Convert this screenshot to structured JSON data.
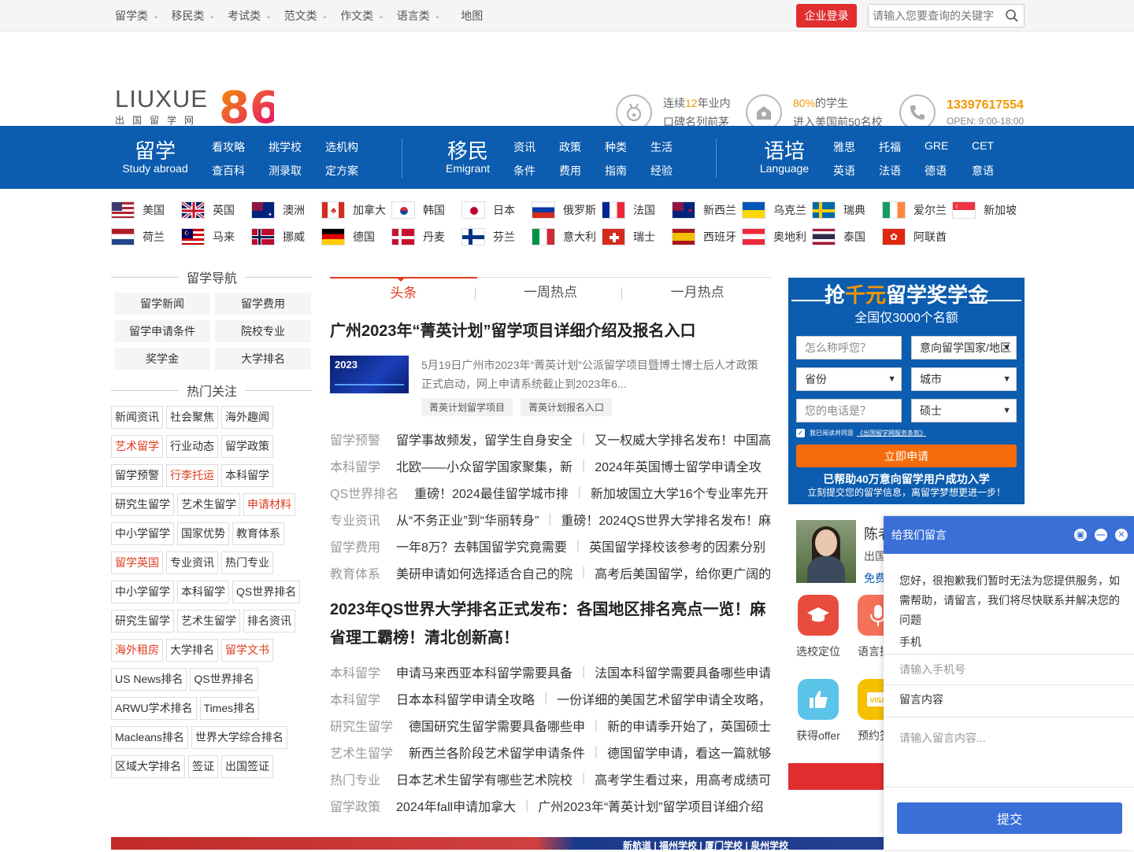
{
  "topnav": {
    "items": [
      {
        "label": "留学类"
      },
      {
        "label": "移民类"
      },
      {
        "label": "考试类"
      },
      {
        "label": "范文类"
      },
      {
        "label": "作文类"
      },
      {
        "label": "语言类"
      }
    ],
    "map": "地图",
    "corp_login": "企业登录",
    "search_placeholder": "请输入您要查询的关键字"
  },
  "header": {
    "logo_text": "LIUXUE",
    "logo_num": "86",
    "logo_sub": "出国留学网",
    "badge1_pre": "连续",
    "badge1_num": "12",
    "badge1_post": "年业内",
    "badge1_line2": "口碑名列前茅",
    "badge2_pct": "80%",
    "badge2_post": "的学生",
    "badge2_line2": "进入美国前50名校",
    "phone": "13397617554",
    "open": "OPEN: 9:00-18:00"
  },
  "bluebar": {
    "study_big": "留学",
    "study_en": "Study abroad",
    "study_links": [
      "看攻略",
      "挑学校",
      "选机构",
      "查百科",
      "测录取",
      "定方案"
    ],
    "emig_big": "移民",
    "emig_en": "Emigrant",
    "emig_links": [
      "资讯",
      "政策",
      "种类",
      "生活",
      "条件",
      "费用",
      "指南",
      "经验"
    ],
    "lang_big": "语培",
    "lang_en": "Language",
    "lang_links": [
      "雅思",
      "托福",
      "GRE",
      "CET",
      "英语",
      "法语",
      "德语",
      "意语"
    ]
  },
  "flags": {
    "row1": [
      "美国",
      "英国",
      "澳洲",
      "加拿大",
      "韩国",
      "日本",
      "俄罗斯",
      "法国",
      "新西兰",
      "乌克兰",
      "瑞典",
      "爱尔兰",
      "新加坡"
    ],
    "row2": [
      "荷兰",
      "马来",
      "挪威",
      "德国",
      "丹麦",
      "芬兰",
      "意大利",
      "瑞士",
      "西班牙",
      "奥地利",
      "泰国",
      "阿联酋"
    ]
  },
  "left": {
    "nav_title": "留学导航",
    "nav": [
      "留学新闻",
      "留学费用",
      "留学申请条件",
      "院校专业",
      "奖学金",
      "大学排名"
    ],
    "hot_title": "热门关注",
    "tags": [
      {
        "t": "新闻资讯",
        "red": false
      },
      {
        "t": "社会聚焦",
        "red": false
      },
      {
        "t": "海外趣闻",
        "red": false
      },
      {
        "t": "艺术留学",
        "red": true
      },
      {
        "t": "行业动态",
        "red": false
      },
      {
        "t": "留学政策",
        "red": false
      },
      {
        "t": "留学预警",
        "red": false
      },
      {
        "t": "行李托运",
        "red": true
      },
      {
        "t": "本科留学",
        "red": false
      },
      {
        "t": "研究生留学",
        "red": false
      },
      {
        "t": "艺术生留学",
        "red": false
      },
      {
        "t": "申请材料",
        "red": true
      },
      {
        "t": "中小学留学",
        "red": false
      },
      {
        "t": "国家优势",
        "red": false
      },
      {
        "t": "教育体系",
        "red": false
      },
      {
        "t": "留学英国",
        "red": true
      },
      {
        "t": "专业资讯",
        "red": false
      },
      {
        "t": "热门专业",
        "red": false
      },
      {
        "t": "中小学留学",
        "red": false
      },
      {
        "t": "本科留学",
        "red": false
      },
      {
        "t": "QS世界排名",
        "red": false
      },
      {
        "t": "研究生留学",
        "red": false
      },
      {
        "t": "艺术生留学",
        "red": false
      },
      {
        "t": "排名资讯",
        "red": false
      },
      {
        "t": "海外租房",
        "red": true
      },
      {
        "t": "大学排名",
        "red": false
      },
      {
        "t": "留学文书",
        "red": true
      },
      {
        "t": "US News排名",
        "red": false
      },
      {
        "t": "QS世界排名",
        "red": false
      },
      {
        "t": "ARWU学术排名",
        "red": false
      },
      {
        "t": "Times排名",
        "red": false
      },
      {
        "t": "Macleans排名",
        "red": false
      },
      {
        "t": "世界大学综合排名",
        "red": false
      },
      {
        "t": "区域大学排名",
        "red": false
      },
      {
        "t": "签证",
        "red": false
      },
      {
        "t": "出国签证",
        "red": false
      }
    ]
  },
  "mid": {
    "tabs": [
      "头条",
      "一周热点",
      "一月热点"
    ],
    "headline1": "广州2023年“菁英计划”留学项目详细介绍及报名入口",
    "thumb_year": "2023",
    "feat_desc": "5月19日广州市2023年“菁英计划”公派留学项目暨博士博士后人才政策正式启动，网上申请系统截止到2023年6...",
    "feat_tags": [
      "菁英计划留学项目",
      "菁英计划报名入口"
    ],
    "list1": [
      {
        "c": "留学预警",
        "a": "留学事故频发，留学生自身安全",
        "b": "又一权威大学排名发布！中国高"
      },
      {
        "c": "本科留学",
        "a": "北欧——小众留学国家聚集，新",
        "b": "2024年英国博士留学申请全攻"
      },
      {
        "c": "QS世界排名",
        "a": "重磅！2024最佳留学城市排",
        "b": "新加坡国立大学16个专业率先开"
      },
      {
        "c": "专业资讯",
        "a": "从“不务正业”到“华丽转身”",
        "b": "重磅！2024QS世界大学排名发布！麻"
      },
      {
        "c": "留学费用",
        "a": "一年8万？去韩国留学究竟需要",
        "b": "英国留学择校该参考的因素分别"
      },
      {
        "c": "教育体系",
        "a": "美研申请如何选择适合自己的院",
        "b": "高考后美国留学，给你更广阔的"
      }
    ],
    "headline2": "2023年QS世界大学排名正式发布：各国地区排名亮点一览！麻省理工霸榜！清北创新高！",
    "list2": [
      {
        "c": "本科留学",
        "a": "申请马来西亚本科留学需要具备",
        "b": "法国本科留学需要具备哪些申请"
      },
      {
        "c": "本科留学",
        "a": "日本本科留学申请全攻略",
        "b": "一份详细的美国艺术留学申请全攻略，"
      },
      {
        "c": "研究生留学",
        "a": "德国研究生留学需要具备哪些申",
        "b": "新的申请季开始了，英国硕士"
      },
      {
        "c": "艺术生留学",
        "a": "新西兰各阶段艺术留学申请条件",
        "b": "德国留学申请，看这一篇就够"
      },
      {
        "c": "热门专业",
        "a": "日本艺术生留学有哪些艺术院校",
        "b": "高考学生看过来，用高考成绩可"
      },
      {
        "c": "留学政策",
        "a": "2024年fall申请加拿大",
        "b": "广州2023年“菁英计划”留学项目详细介绍"
      }
    ]
  },
  "right": {
    "title_pre": "抢",
    "title_em": "千元",
    "title_post": "留学奖学金",
    "subtitle": "全国仅3000个名额",
    "name_placeholder": "怎么称呼您？",
    "country_placeholder": "意向留学国家/地区",
    "province": "省份",
    "city": "城市",
    "phone_placeholder": "您的电话是？",
    "degree": "硕士",
    "agree_text": "我已阅读并同意",
    "agree_link": "《出国留学网服务条款》",
    "apply": "立即申请",
    "ok1": "已帮助40万意向留学用户成功入学",
    "ok2": "立刻提交您的留学信息，离留学梦想更进一步！",
    "advisor_name": "陈老",
    "advisor_line2": "出国",
    "advisor_line3": "免费",
    "svc1": "选校定位",
    "svc2": "语言提",
    "svc3": "获得offer",
    "svc4": "预约签"
  },
  "banner": {
    "text": "新航道 | 福州学校 | 厦门学校 | 泉州学校"
  },
  "chat": {
    "title": "给我们留言",
    "message": "您好，很抱歉我们暂时无法为您提供服务，如需帮助，请留言，我们将尽快联系并解决您的问题",
    "phone_label": "手机",
    "phone_placeholder": "请输入手机号",
    "content_label": "留言内容",
    "content_placeholder": "请输入留言内容...",
    "submit": "提交"
  }
}
